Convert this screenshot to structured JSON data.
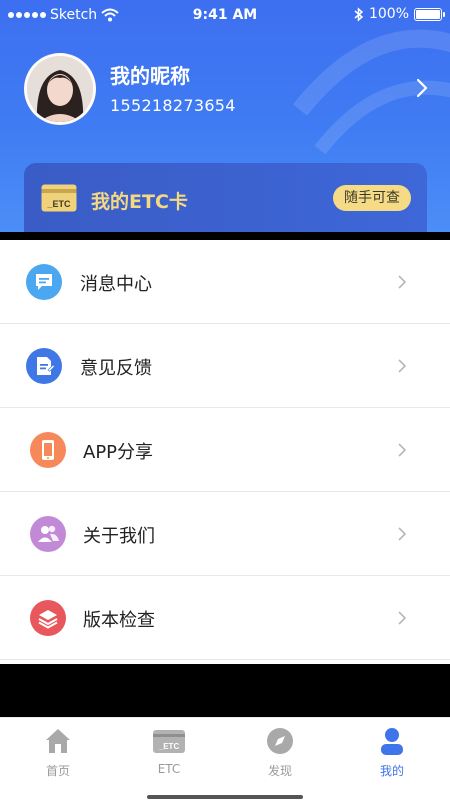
{
  "status_bar": {
    "carrier": "Sketch",
    "time": "9:41 AM",
    "battery": "100%"
  },
  "profile": {
    "nickname": "我的昵称",
    "phone": "155218273654"
  },
  "etc_card": {
    "icon_text": "_ETC",
    "title": "我的ETC卡",
    "query_button": "随手可查"
  },
  "menu": [
    {
      "label": "消息中心",
      "icon": "message-icon",
      "color": "#4ba7ef"
    },
    {
      "label": "意见反馈",
      "icon": "feedback-doc-icon",
      "color": "#3f77e6"
    },
    {
      "label": "APP分享",
      "icon": "phone-share-icon",
      "color": "#f7885a"
    },
    {
      "label": "关于我们",
      "icon": "about-users-icon",
      "color": "#c28ad6"
    },
    {
      "label": "版本检查",
      "icon": "layers-icon",
      "color": "#e8575b"
    }
  ],
  "tabbar": [
    {
      "label": "首页",
      "icon": "home-icon",
      "active": false
    },
    {
      "label": "ETC",
      "icon": "etc-card-icon",
      "icon_text": "_ETC",
      "active": false
    },
    {
      "label": "发现",
      "icon": "compass-icon",
      "active": false
    },
    {
      "label": "我的",
      "icon": "user-icon",
      "active": true
    }
  ],
  "colors": {
    "header_blue": "#3f7cf3",
    "active_tab": "#3f74ea",
    "etc_gold": "#f5d882"
  }
}
